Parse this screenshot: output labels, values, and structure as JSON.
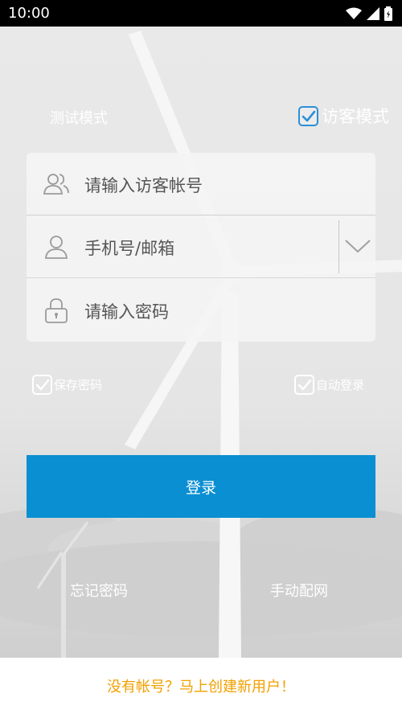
{
  "status_bar": {
    "time": "10:00"
  },
  "mode": {
    "test_label": "测试模式",
    "guest_label": "访客模式",
    "guest_checked": true
  },
  "form": {
    "guest_account_placeholder": "请输入访客帐号",
    "phone_email_placeholder": "手机号/邮箱",
    "password_placeholder": "请输入密码"
  },
  "options": {
    "save_password": "保存密码",
    "auto_login": "自动登录"
  },
  "login_button": "登录",
  "links": {
    "forgot_password": "忘记密码",
    "manual_network": "手动配网"
  },
  "footer": {
    "register_text": "没有帐号？马上创建新用户！"
  },
  "colors": {
    "accent": "#0a8fd2",
    "footer_text": "#f0a000",
    "checkbox_accent": "#2b8fd6"
  }
}
